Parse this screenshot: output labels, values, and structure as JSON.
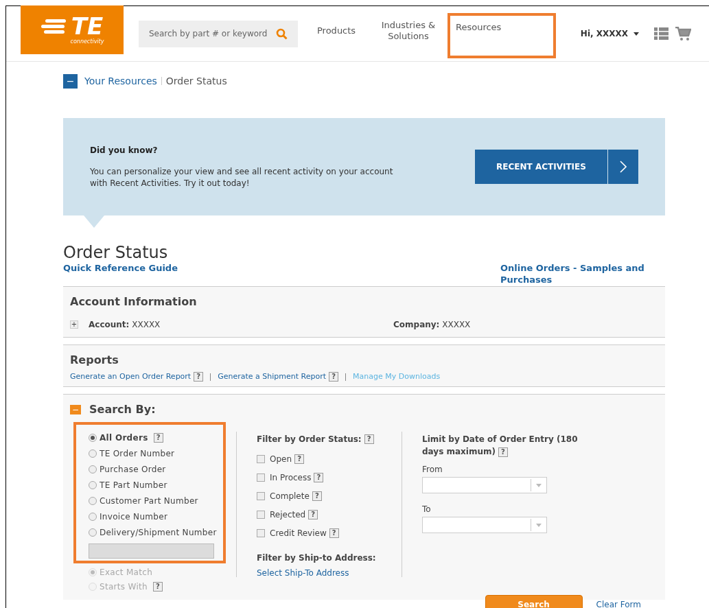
{
  "header": {
    "logo": {
      "mark": "TE",
      "tagline": "connectivity"
    },
    "search": {
      "placeholder": "Search by part # or keyword"
    },
    "nav": [
      {
        "label": "Products",
        "highlighted": false
      },
      {
        "label": "Industries & Solutions",
        "highlighted": false
      },
      {
        "label": "Resources",
        "highlighted": true
      }
    ],
    "user": "Hi, XXXXX"
  },
  "breadcrumb": {
    "toggle": "−",
    "items": [
      {
        "label": "Your Resources",
        "link": true
      },
      {
        "label": "Order Status",
        "link": false
      }
    ]
  },
  "banner": {
    "title": "Did you know?",
    "text": "You can personalize your view and see all recent activity on your account with Recent Activities. Try it out today!",
    "button": "RECENT ACTIVITIES"
  },
  "page_title": "Order Status",
  "links": [
    "Quick Reference Guide",
    "Online Orders - Samples and Purchases"
  ],
  "account": {
    "title": "Account Information",
    "toggle": "+",
    "fields": [
      {
        "label": "Account:",
        "value": "XXXXX"
      },
      {
        "label": "Company:",
        "value": "XXXXX"
      }
    ]
  },
  "reports": {
    "title": "Reports",
    "links": [
      {
        "label": "Generate an Open Order Report",
        "help": "?",
        "kind": "primary"
      },
      {
        "label": "Generate a Shipment Report",
        "help": "?",
        "kind": "primary"
      },
      {
        "label": "Manage My Downloads",
        "kind": "light"
      }
    ]
  },
  "search_by": {
    "title": "Search By:",
    "toggle": "−",
    "highlighted": true,
    "options": [
      {
        "label": "All Orders",
        "selected": true,
        "help": "?"
      },
      {
        "label": "TE Order Number",
        "selected": false
      },
      {
        "label": "Purchase Order",
        "selected": false
      },
      {
        "label": "TE Part Number",
        "selected": false
      },
      {
        "label": "Customer Part Number",
        "selected": false
      },
      {
        "label": "Invoice Number",
        "selected": false
      },
      {
        "label": "Delivery/Shipment Number",
        "selected": false
      }
    ],
    "match": [
      {
        "label": "Exact Match",
        "selected": true,
        "disabled": true
      },
      {
        "label": "Starts With",
        "selected": false,
        "disabled": true,
        "help": "?"
      }
    ]
  },
  "status_filter": {
    "title": "Filter by Order Status:",
    "help": "?",
    "items": [
      {
        "label": "Open",
        "checked": false,
        "help": "?"
      },
      {
        "label": "In Process",
        "checked": false,
        "help": "?"
      },
      {
        "label": "Complete",
        "checked": false,
        "help": "?"
      },
      {
        "label": "Rejected",
        "checked": false,
        "help": "?"
      },
      {
        "label": "Credit Review",
        "checked": false,
        "help": "?"
      }
    ],
    "ship_title": "Filter by Ship-to Address:",
    "ship_link": "Select Ship-To Address"
  },
  "date_filter": {
    "title": "Limit by Date of Order Entry (180 days maximum)",
    "help": "?",
    "fields": [
      {
        "label": "From"
      },
      {
        "label": "To"
      }
    ]
  },
  "actions": {
    "search": "Search",
    "clear": "Clear Form"
  }
}
